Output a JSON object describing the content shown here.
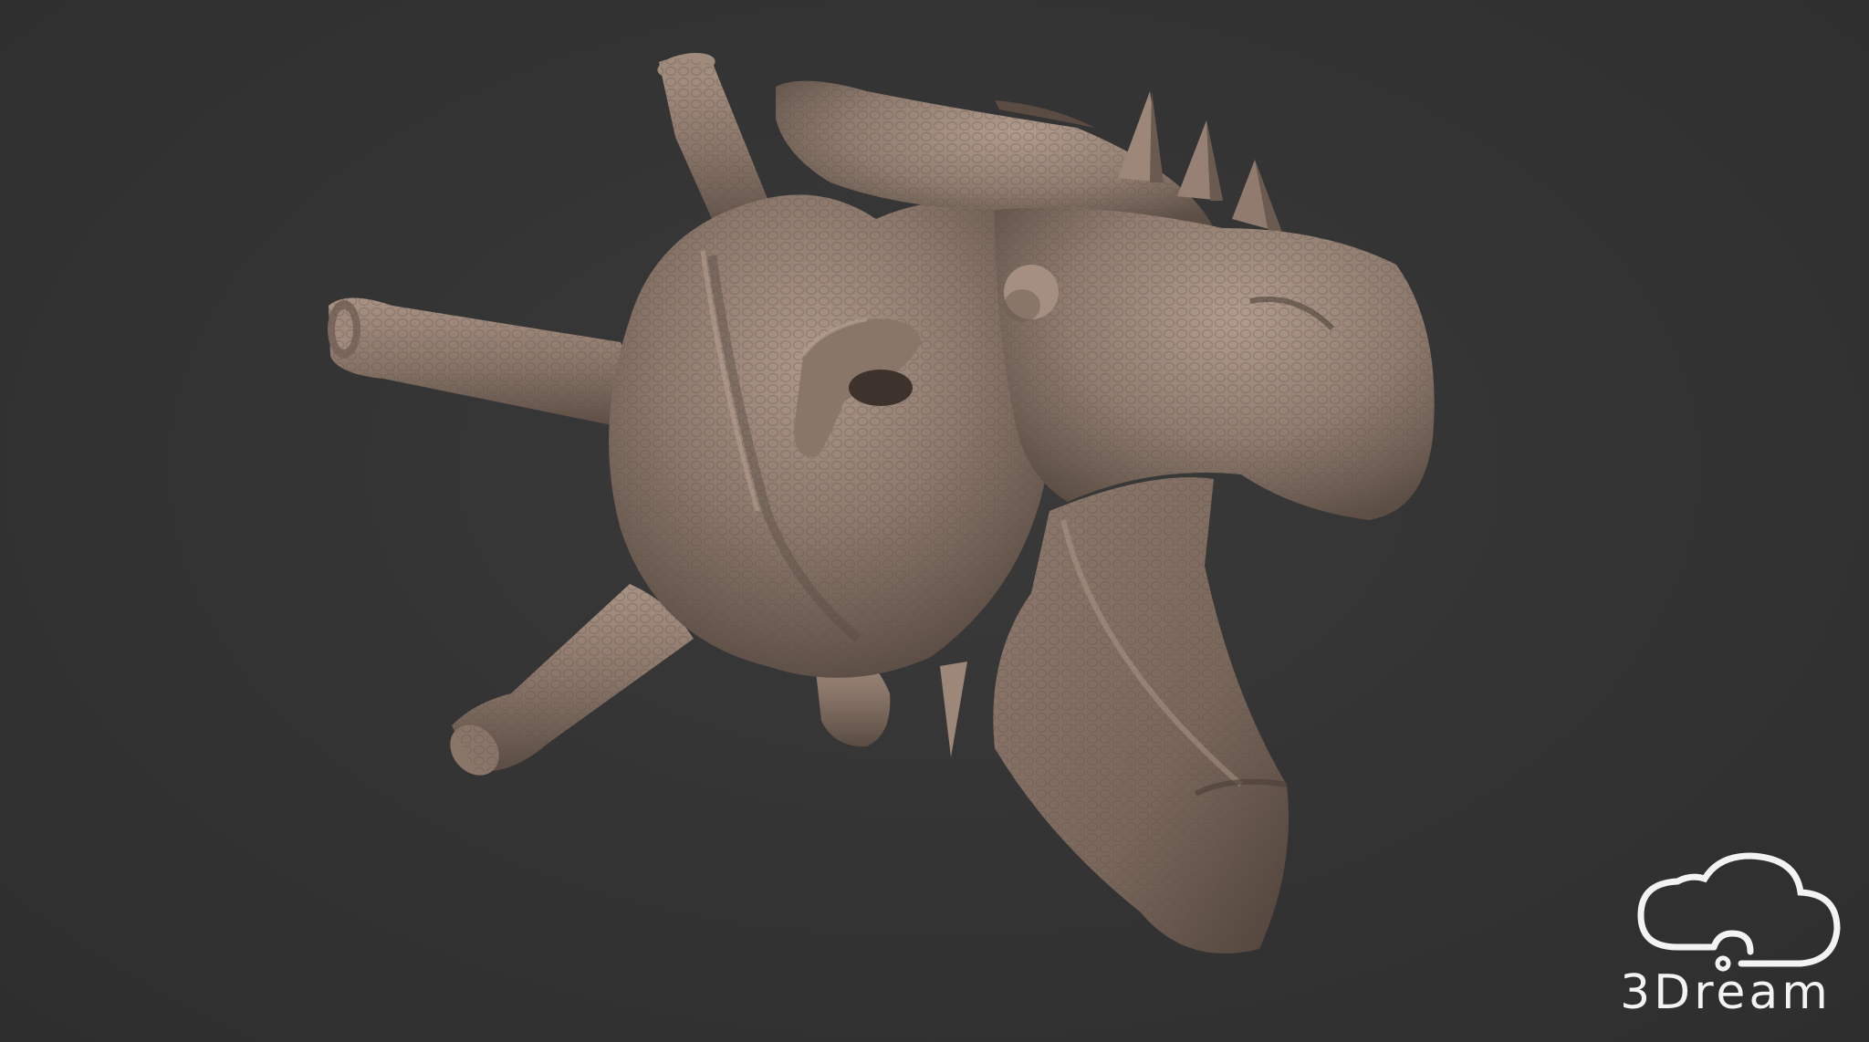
{
  "scene": {
    "background_color": "#323232",
    "model_color": "#8c786c",
    "model_highlight_color": "#b4a092",
    "model_shadow_color": "#4a3e37",
    "subject_icon": "sculpted-heart-model"
  },
  "watermark": {
    "logo_icon": "cloud-logo-icon",
    "text": "3Dream",
    "color": "#f3f3f3"
  }
}
